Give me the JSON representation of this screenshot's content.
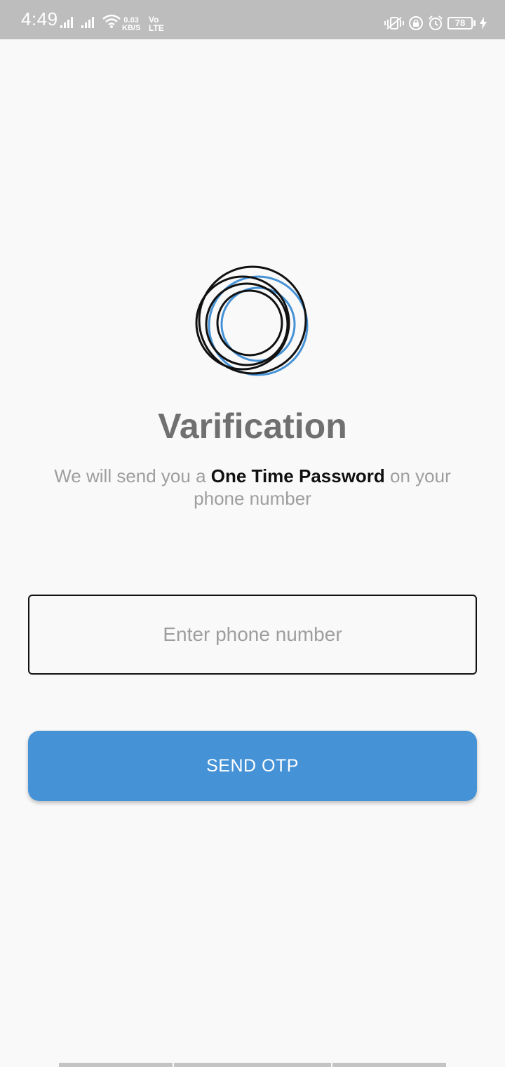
{
  "status_bar": {
    "time": "4:49",
    "net_speed_value": "0.03",
    "net_speed_unit": "KB/S",
    "volte_top": "Vo",
    "volte_bottom": "LTE",
    "battery": "78",
    "icons": [
      "signal-icon",
      "signal-icon",
      "wifi-icon",
      "vibrate-icon",
      "rotation-lock-icon",
      "alarm-icon",
      "battery-icon",
      "charging-icon"
    ]
  },
  "screen": {
    "logo_icon": "concentric-rings-logo-icon",
    "title": "Varification",
    "subtitle_prefix": "We will send you a ",
    "subtitle_bold": "One Time Password",
    "subtitle_suffix": " on your phone number",
    "phone_input": {
      "placeholder": "Enter phone number",
      "value": ""
    },
    "send_button_label": "SEND OTP"
  },
  "colors": {
    "accent": "#4592d6",
    "background": "#f9f9f9",
    "status_bar": "#bdbdbd",
    "title": "#707070",
    "subtitle": "#9e9e9e"
  }
}
